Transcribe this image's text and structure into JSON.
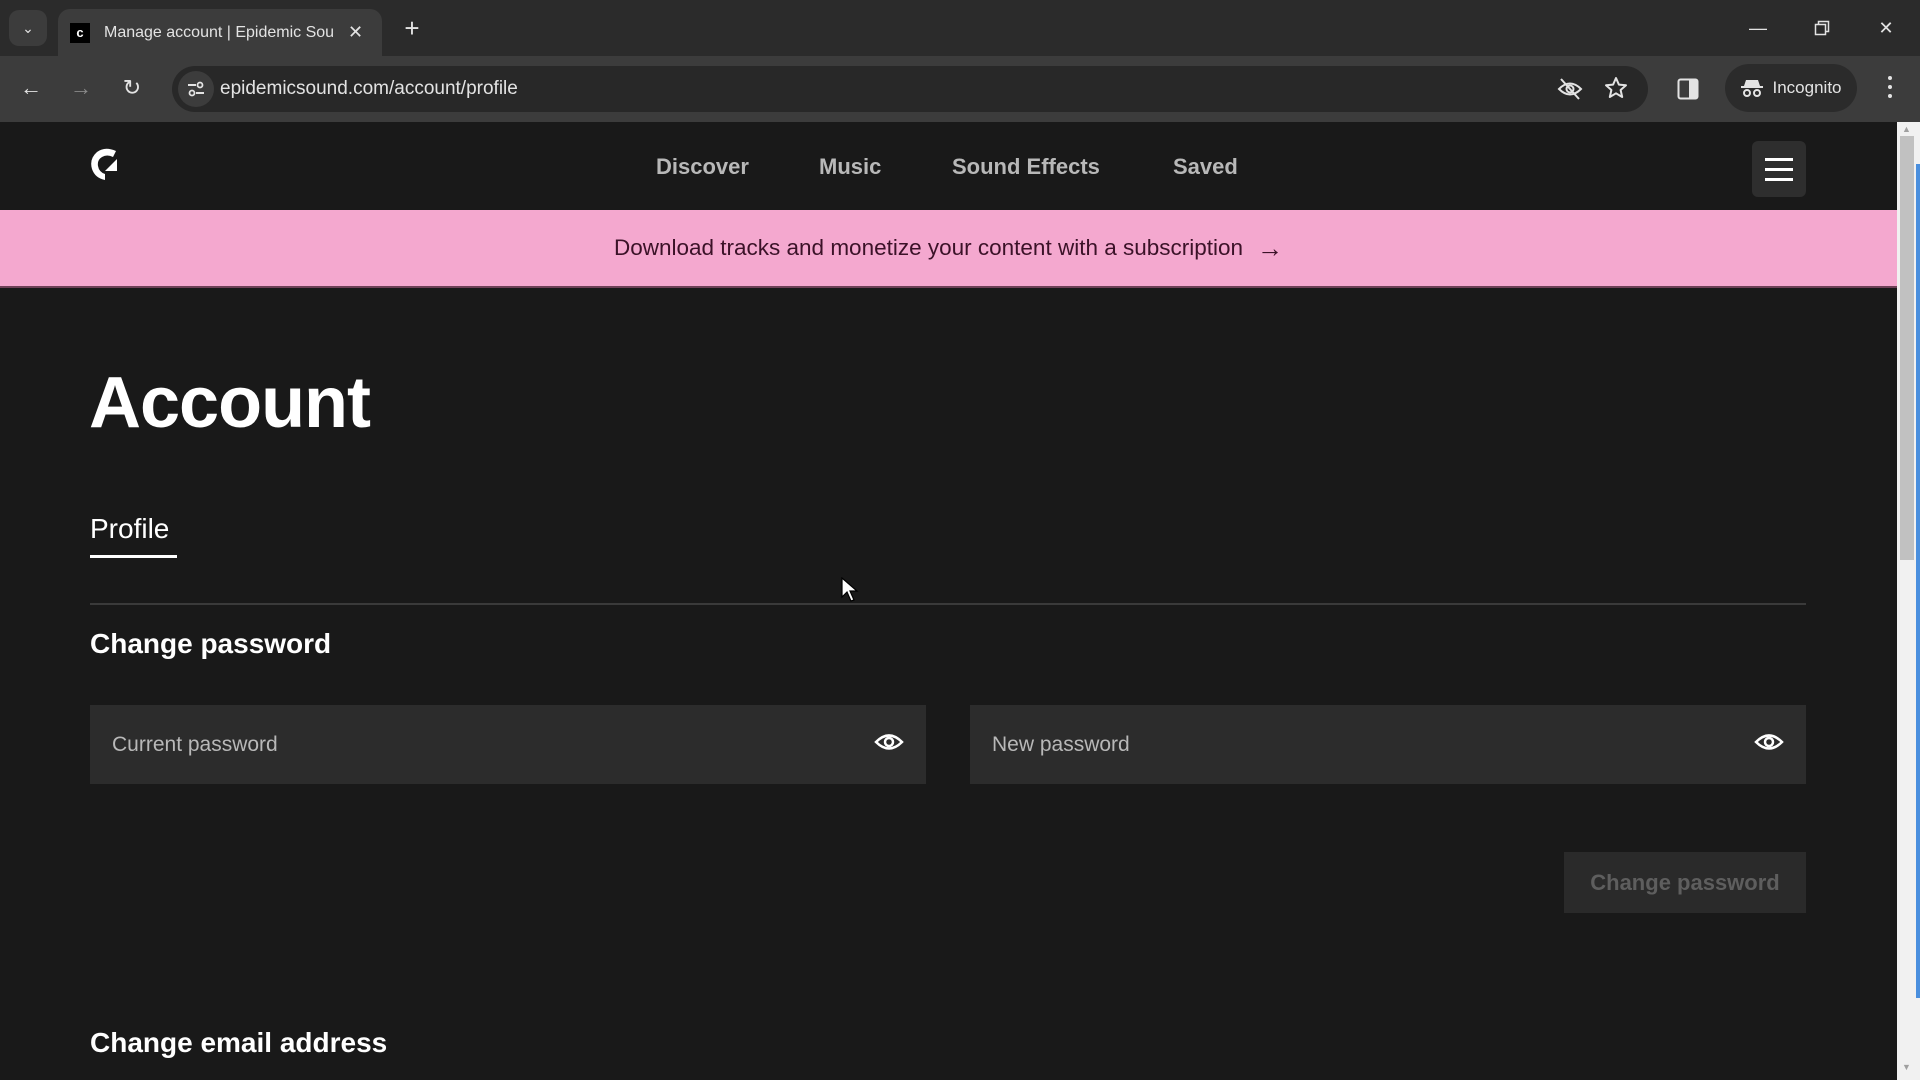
{
  "browser": {
    "tab": {
      "title": "Manage account | Epidemic Sou",
      "favicon": "epidemic-sound-favicon"
    },
    "new_tab_label": "+",
    "url": "epidemicsound.com/account/profile",
    "incognito_label": "Incognito",
    "icons": {
      "tab_search": "chevron-down-icon",
      "back": "back-arrow-icon",
      "forward": "forward-arrow-icon",
      "reload": "reload-icon",
      "site_info": "tune-icon",
      "eye_off": "eye-off-icon",
      "bookmark": "star-icon",
      "side_panel": "side-panel-icon",
      "menu": "kebab-menu-icon"
    }
  },
  "header": {
    "nav": [
      {
        "label": "Discover"
      },
      {
        "label": "Music"
      },
      {
        "label": "Sound Effects"
      },
      {
        "label": "Saved"
      }
    ],
    "menu_icon": "hamburger-icon"
  },
  "banner": {
    "text": "Download tracks and monetize your content with a subscription",
    "arrow": "→",
    "color": "#f4a8cf"
  },
  "main": {
    "title": "Account",
    "tabs": [
      {
        "label": "Profile",
        "active": true
      }
    ],
    "change_password": {
      "title": "Change password",
      "current_placeholder": "Current password",
      "current_value": "",
      "new_placeholder": "New password",
      "new_value": "",
      "submit_label": "Change password",
      "submit_disabled": true
    },
    "change_email": {
      "title": "Change email address"
    }
  },
  "colors": {
    "page_bg": "#191919",
    "input_bg": "#2c2c2c",
    "accent_pink": "#f4a8cf"
  }
}
